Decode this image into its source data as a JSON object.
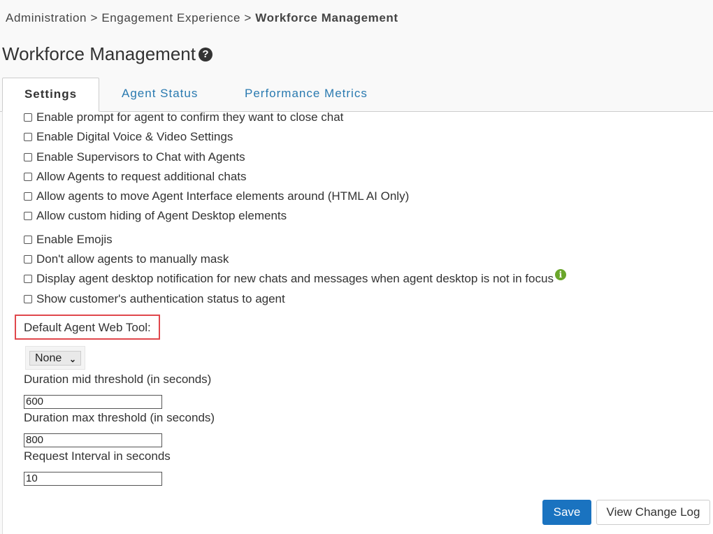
{
  "breadcrumb": {
    "items": [
      "Administration",
      "Engagement Experience"
    ],
    "separator": ">",
    "current": "Workforce Management"
  },
  "page": {
    "title": "Workforce Management",
    "help_icon": "question-circle-icon"
  },
  "tabs": [
    {
      "label": "Settings",
      "active": true
    },
    {
      "label": "Agent Status",
      "active": false
    },
    {
      "label": "Performance Metrics",
      "active": false
    }
  ],
  "settings": {
    "checkboxes": [
      {
        "label": "Enable prompt for agent to confirm they want to close chat",
        "checked": false
      },
      {
        "label": "Enable Digital Voice & Video Settings",
        "checked": false
      },
      {
        "label": "Enable Supervisors to Chat with Agents",
        "checked": false
      },
      {
        "label": "Allow Agents to request additional chats",
        "checked": false
      },
      {
        "label": "Allow agents to move Agent Interface elements around (HTML AI Only)",
        "checked": false
      },
      {
        "label": "Allow custom hiding of Agent Desktop elements",
        "checked": false
      },
      {
        "label": "Enable Emojis",
        "checked": false
      },
      {
        "label": "Don't allow agents to manually mask",
        "checked": false
      },
      {
        "label": "Display agent desktop notification for new chats and messages when agent desktop is not in focus",
        "checked": false,
        "info_icon": "info-icon"
      },
      {
        "label": "Show customer's authentication status to agent",
        "checked": false
      }
    ],
    "default_web_tool": {
      "label": "Default Agent Web Tool:",
      "selected": "None"
    },
    "duration_mid": {
      "label": "Duration mid threshold (in seconds)",
      "value": "600"
    },
    "duration_max": {
      "label": "Duration max threshold (in seconds)",
      "value": "800"
    },
    "request_interval": {
      "label": "Request Interval in seconds",
      "value": "10"
    }
  },
  "actions": {
    "save_label": "Save",
    "view_log_label": "View Change Log"
  },
  "colors": {
    "accent": "#1a73c0",
    "link": "#2a7ab0",
    "highlight": "#e0474c",
    "info": "#6aa62b"
  }
}
